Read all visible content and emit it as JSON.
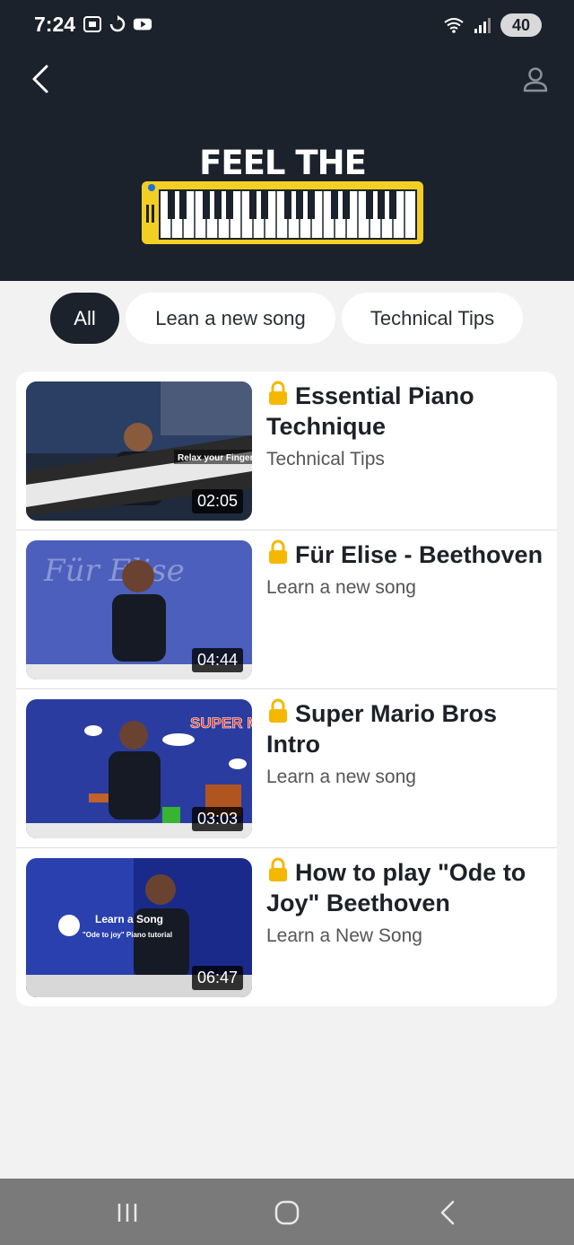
{
  "status_bar": {
    "time": "7:24",
    "battery": "40"
  },
  "header": {
    "logo_text": "FEEL THE MUSIC!"
  },
  "filters": [
    {
      "label": "All",
      "active": true
    },
    {
      "label": "Lean a new song",
      "active": false
    },
    {
      "label": "Technical Tips",
      "active": false
    }
  ],
  "videos": [
    {
      "title": "Essential Piano Technique",
      "category": "Technical Tips",
      "duration": "02:05",
      "thumb_caption": "Relax your Finger"
    },
    {
      "title": "Für Elise - Beethoven",
      "category": "Learn a new song",
      "duration": "04:44",
      "thumb_caption": "Für Elise"
    },
    {
      "title": "Super Mario Bros Intro",
      "category": "Learn a new song",
      "duration": "03:03",
      "thumb_caption": "SUPER MARIO"
    },
    {
      "title": "How to play \"Ode to Joy\" Beethoven",
      "category": "Learn a New Song",
      "duration": "06:47",
      "thumb_caption": "Learn a Song",
      "thumb_subcaption": "\"Ode to joy\" Piano tutorial"
    }
  ],
  "colors": {
    "header_bg": "#1c222b",
    "accent_yellow": "#f3cf24",
    "lock": "#f5b800"
  }
}
